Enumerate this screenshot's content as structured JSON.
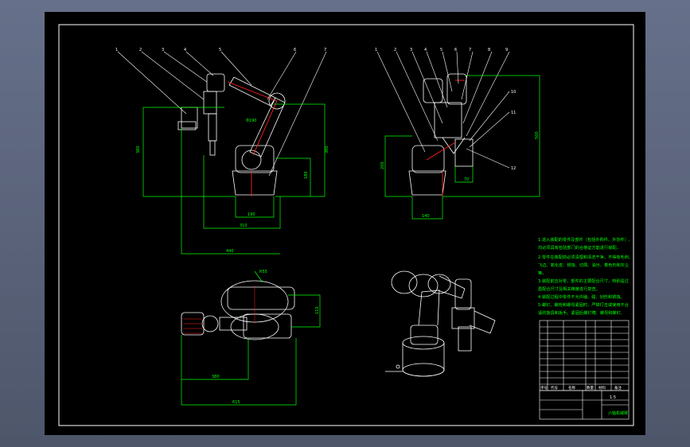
{
  "title_block": {
    "company": "",
    "drawing_name": "六轴机械臂",
    "scale": "1:5"
  },
  "dimensions": {
    "front": {
      "height_total": "380",
      "width_total": "440",
      "width_mid": "310",
      "width_base": "190",
      "height_base": "180",
      "base_d": "Φ190"
    },
    "side": {
      "height_total": "500",
      "height_left": "200",
      "width_base": "140",
      "small": "70"
    },
    "top": {
      "width": "380",
      "length": "615",
      "height": "110",
      "radius": "R55"
    }
  },
  "balloons_front": [
    "1",
    "2",
    "3",
    "4",
    "5",
    "6",
    "7"
  ],
  "balloons_side": [
    "1",
    "2",
    "3",
    "4",
    "5",
    "6",
    "7",
    "8",
    "9",
    "10",
    "11",
    "12"
  ],
  "tech_notes": [
    "1.进入装配的零件及部件（包括外购件、外协件）,",
    "均必须具有检验部门的合格证方能进行装配。",
    "2.零件在装配前必须清理和清洗干净，不得有毛刺、",
    "飞边、氧化皮、锈蚀、切屑、油污、着色剂和灰尘",
    "等。",
    "3.装配前应对零、部件的主要配合尺寸，特别是过",
    "盈配合尺寸及相关精度进行复查。",
    "4.装配过程中零件不允许磕、碰、划伤和锈蚀。",
    "5.螺钉、螺栓和螺母紧固时，严禁打击或使用不合",
    "适的旋具和扳手。紧固后螺钉槽、螺母和螺钉、"
  ],
  "bom_headers": [
    "序号",
    "代号",
    "名称",
    "数量",
    "材料",
    "备注"
  ],
  "colors": {
    "sheet": "#000000",
    "frame": "#ffffff",
    "dimension": "#00ff00",
    "leader": "#ffffff",
    "notes": "#00ff00",
    "accent_red": "#ff2020",
    "title_block_line": "#ffffff"
  }
}
